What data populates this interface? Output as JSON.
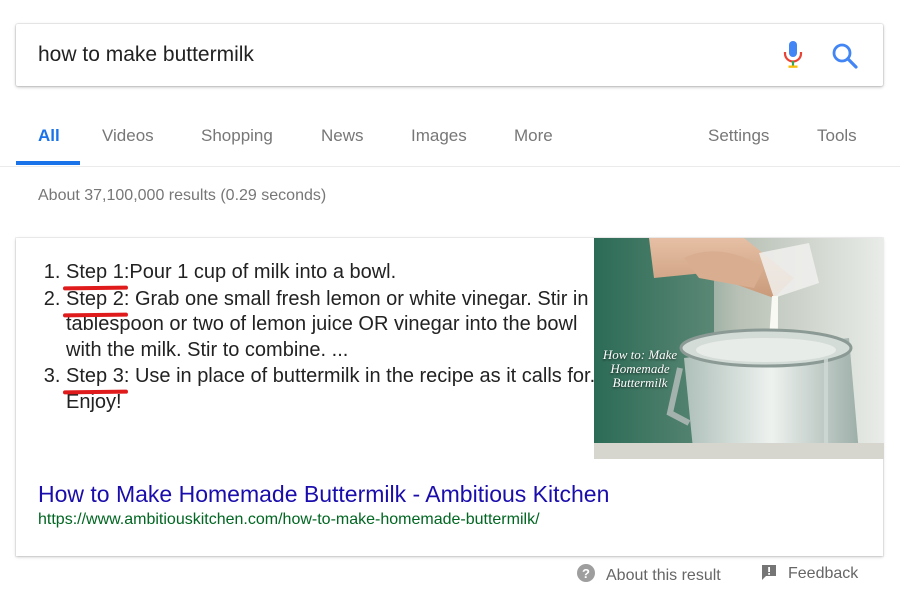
{
  "search": {
    "query": "how to make buttermilk"
  },
  "tabs": [
    {
      "label": "All"
    },
    {
      "label": "Videos"
    },
    {
      "label": "Shopping"
    },
    {
      "label": "News"
    },
    {
      "label": "Images"
    },
    {
      "label": "More"
    },
    {
      "label": "Settings"
    },
    {
      "label": "Tools"
    }
  ],
  "active_tab": "All",
  "result_stats": "About 37,100,000 results (0.29 seconds)",
  "snippet": {
    "steps": [
      {
        "label": "Step 1",
        "text": ":Pour 1 cup of milk into a bowl."
      },
      {
        "label": "Step 2",
        "text": ": Grab one small fresh lemon or white vinegar. Stir in a tablespoon or two of lemon juice OR vinegar into the bowl with the milk. Stir to combine. ..."
      },
      {
        "label": "Step 3",
        "text": ": Use in place of buttermilk in the recipe as it calls for. Enjoy!"
      }
    ],
    "image_caption": "How to: Make Homemade Buttermilk",
    "title": "How to Make Homemade Buttermilk - Ambitious Kitchen",
    "url": "https://www.ambitiouskitchen.com/how-to-make-homemade-buttermilk/"
  },
  "footer": {
    "about": "About this result",
    "feedback": "Feedback"
  },
  "colors": {
    "link": "#1a0dab",
    "url": "#006621",
    "accent": "#1a73e8",
    "annotation": "#e01b1b"
  },
  "icons": [
    "microphone-icon",
    "search-icon",
    "help-circle-icon",
    "feedback-flag-icon"
  ]
}
